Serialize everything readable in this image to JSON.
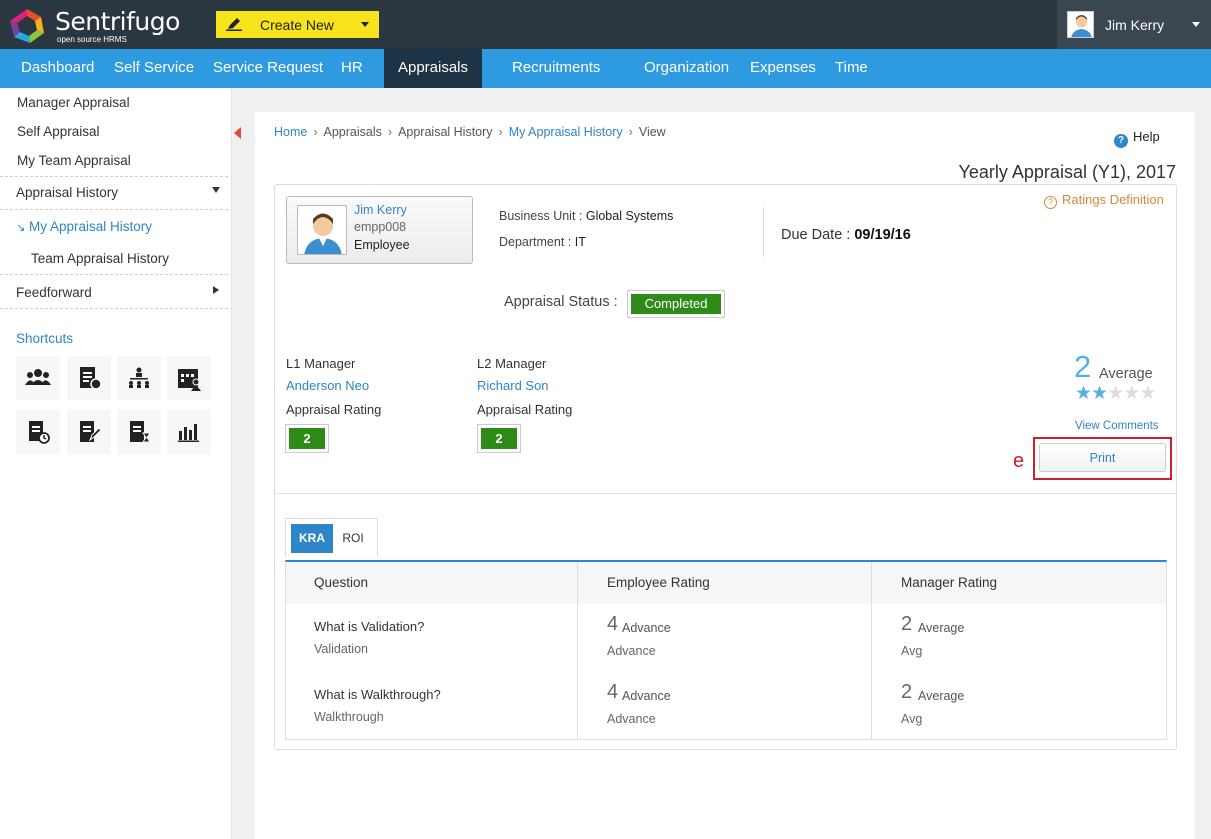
{
  "header": {
    "logo_name": "Sentrifugo",
    "logo_sub": "open source HRMS",
    "create_label": "Create New",
    "user_name": "Jim Kerry"
  },
  "nav": [
    {
      "label": "Dashboard"
    },
    {
      "label": "Self Service"
    },
    {
      "label": "Service Request"
    },
    {
      "label": "HR"
    },
    {
      "label": "Appraisals"
    },
    {
      "label": "Recruitments"
    },
    {
      "label": "Organization"
    },
    {
      "label": "Expenses"
    },
    {
      "label": "Time"
    }
  ],
  "sidebar": {
    "manager_appraisal": "Manager Appraisal",
    "self_appraisal": "Self Appraisal",
    "my_team_appraisal": "My Team Appraisal",
    "appraisal_history": "Appraisal History",
    "my_appraisal_history": "My Appraisal History",
    "team_appraisal_history": "Team Appraisal History",
    "feedforward": "Feedforward",
    "shortcuts_title": "Shortcuts",
    "shortcut_icons": [
      "people-icon",
      "report-icon",
      "org-chart-icon",
      "calendar-user-icon",
      "document-clock-icon",
      "document-edit-icon",
      "document-timer-icon",
      "bar-chart-icon"
    ]
  },
  "breadcrumb": {
    "home": "Home",
    "appraisals": "Appraisals",
    "appraisal_history": "Appraisal History",
    "my_appraisal_history": "My Appraisal History",
    "view": "View",
    "separator": "›"
  },
  "help_label": "Help",
  "page_title": "Yearly Appraisal (Y1), 2017",
  "ratings_definition": "Ratings Definition",
  "employee": {
    "name": "Jim Kerry",
    "id": "empp008",
    "role": "Employee"
  },
  "details": {
    "business_unit_label": "Business Unit : ",
    "business_unit": "Global Systems",
    "department_label": "Department : ",
    "department": "IT",
    "due_date_label": "Due Date : ",
    "due_date": "09/19/16"
  },
  "status": {
    "label": "Appraisal Status :",
    "value": "Completed"
  },
  "managers": {
    "l1_label": "L1 Manager",
    "l1_name": "Anderson Neo",
    "l1_rating_label": "Appraisal Rating",
    "l1_rating": "2",
    "l2_label": "L2 Manager",
    "l2_name": "Richard Son",
    "l2_rating_label": "Appraisal Rating",
    "l2_rating": "2"
  },
  "overall": {
    "score": "2",
    "word": "Average",
    "stars_filled": 2,
    "stars_total": 5,
    "view_comments": "View Comments",
    "print": "Print",
    "highlight_label": "e"
  },
  "tabs": [
    {
      "label": "KRA",
      "active": true
    },
    {
      "label": "ROI",
      "active": false
    }
  ],
  "table": {
    "headers": [
      "Question",
      "Employee Rating",
      "Manager Rating"
    ],
    "rows": [
      {
        "question": "What is Validation?",
        "sub": "Validation",
        "emp_score": "4",
        "emp_word": "Advance",
        "emp_comment": "Advance",
        "mgr_score": "2",
        "mgr_word": "Average",
        "mgr_comment": "Avg"
      },
      {
        "question": "What is Walkthrough?",
        "sub": "Walkthrough",
        "emp_score": "4",
        "emp_word": "Advance",
        "emp_comment": "Advance",
        "mgr_score": "2",
        "mgr_word": "Average",
        "mgr_comment": "Avg"
      }
    ]
  },
  "colors": {
    "topbar": "#2a3640",
    "nav": "#2e9ae0",
    "nav_active": "#1d3447",
    "create_button": "#f7e41c",
    "link": "#2e85c8",
    "status_green": "#2e8b17",
    "star": "#55b2e0",
    "highlight": "#c8202e"
  }
}
